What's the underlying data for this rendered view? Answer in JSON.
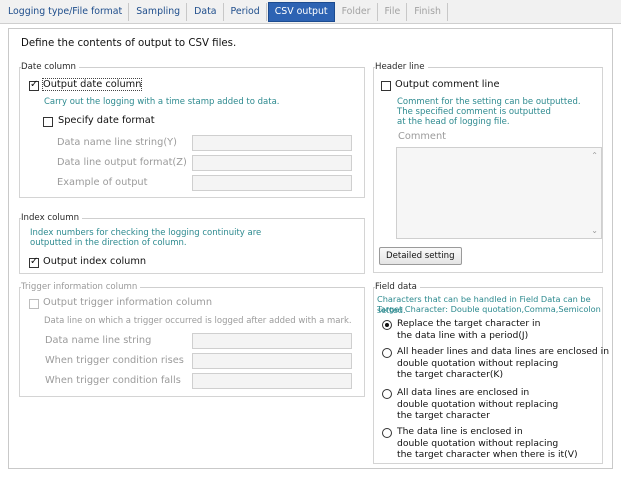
{
  "tabs": [
    {
      "label": "Logging type/File format",
      "state": "normal"
    },
    {
      "label": "Sampling",
      "state": "normal"
    },
    {
      "label": "Data",
      "state": "normal"
    },
    {
      "label": "Period",
      "state": "normal"
    },
    {
      "label": "CSV output",
      "state": "active"
    },
    {
      "label": "Folder",
      "state": "disabled"
    },
    {
      "label": "File",
      "state": "disabled"
    },
    {
      "label": "Finish",
      "state": "disabled"
    }
  ],
  "title": "Define the contents of output to CSV files.",
  "date_column": {
    "legend": "Date column",
    "output_date_label": "Output date column",
    "output_date_checked": true,
    "note": "Carry out the logging with a time stamp added to data.",
    "specify_format_label": "Specify date format",
    "specify_format_checked": false,
    "name_string_label": "Data name line string(Y)",
    "name_string_value": "",
    "output_format_label": "Data line output format(Z)",
    "output_format_value": "",
    "example_label": "Example of output",
    "example_value": ""
  },
  "index_column": {
    "legend": "Index column",
    "note_line1": "Index numbers for checking the logging continuity are",
    "note_line2": "outputted in the direction of column.",
    "output_index_label": "Output index column",
    "output_index_checked": true
  },
  "trigger_column": {
    "legend": "Trigger information column",
    "output_trigger_label": "Output trigger information column",
    "output_trigger_checked": false,
    "note": "Data line on which a trigger occurred is logged after added with a mark.",
    "name_string_label": "Data name line string",
    "name_string_value": "",
    "rises_label": "When trigger condition rises",
    "rises_value": "",
    "falls_label": "When trigger condition falls",
    "falls_value": ""
  },
  "header_line": {
    "legend": "Header line",
    "output_comment_label": "Output comment line",
    "output_comment_checked": false,
    "note_line1": "Comment for the setting can be outputted.",
    "note_line2": "The specified comment is outputted",
    "note_line3": "at the head of logging file.",
    "comment_label": "Comment",
    "comment_value": "",
    "detailed_button": "Detailed setting"
  },
  "field_data": {
    "legend": "Field data",
    "note_line1": "Characters that can be handled in Field Data can be setted.",
    "note_line2": "Target Character: Double quotation,Comma,Semicolon",
    "options": [
      {
        "line1": "Replace the target character in",
        "line2": "the data line with a period(J)",
        "line3": "",
        "selected": true
      },
      {
        "line1": "All header lines and data lines are enclosed in",
        "line2": "double quotation without replacing",
        "line3": "the target character(K)",
        "selected": false
      },
      {
        "line1": "All data lines are enclosed in",
        "line2": "double quotation without replacing",
        "line3": "the target character",
        "selected": false
      },
      {
        "line1": "The data line is enclosed in",
        "line2": "double quotation without replacing",
        "line3": "the target character when there is it(V)",
        "selected": false
      }
    ]
  },
  "colors": {
    "accent": "#2d63b3",
    "note_teal": "#2d8a8f",
    "disabled": "#9b9b9b"
  }
}
